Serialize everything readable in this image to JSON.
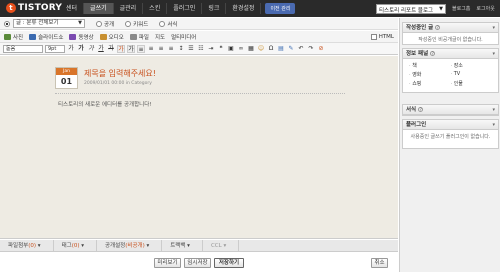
{
  "app": {
    "logo_mark": "t",
    "logo_text": "TISTORY"
  },
  "top_menu": {
    "items": [
      {
        "label": "센터"
      },
      {
        "label": "글쓰기"
      },
      {
        "label": "글관리"
      },
      {
        "label": "스킨"
      },
      {
        "label": "플러그인"
      },
      {
        "label": "링크"
      },
      {
        "label": "환경설정"
      }
    ],
    "preview_button": "이전 관리",
    "blog_select": "티스토리 리포트 블로그",
    "links": [
      "블로그홈",
      "로그아웃"
    ]
  },
  "category_row": {
    "category_label": "글 : 분류 전체보기",
    "options": [
      "공개",
      "키워드",
      "서식"
    ]
  },
  "insert_row": {
    "items": [
      "사진",
      "슬라이드쇼",
      "동영상",
      "오디오",
      "파일",
      "지도",
      "멀티미디어"
    ],
    "html_label": "HTML"
  },
  "format_row": {
    "font_select": "돋움",
    "size_select": "9pt"
  },
  "post": {
    "month": "Jan",
    "day": "01",
    "title": "제목을 입력해주세요!",
    "meta": "2009/01/01 00:00 in Category",
    "body": "티스토리의 새로운 에디터를 공개합니다!"
  },
  "bottom_tabs": [
    {
      "label": "파일첨부",
      "count": "(0)"
    },
    {
      "label": "태그",
      "count": "(0)"
    },
    {
      "label": "공개설정",
      "count": "(비공개)"
    },
    {
      "label": "트랙백"
    },
    {
      "label": "CCL"
    }
  ],
  "actions": {
    "preview": "미리보기",
    "draft": "임시저장",
    "save": "저장하기",
    "cancel": "취소"
  },
  "sidebar": {
    "writing_panel": {
      "title": "작성중인 글",
      "message": "작성중인 비공개글이 없습니다."
    },
    "info_panel": {
      "title": "정보 패널",
      "items": [
        "책",
        "장소",
        "영화",
        "TV",
        "쇼핑",
        "인물"
      ]
    },
    "format_panel": {
      "title": "서식"
    },
    "plugin_panel": {
      "title": "플러그인",
      "message": "사용중인 글쓰기 플러그인이 없습니다."
    }
  },
  "colors": {
    "accent": "#c8501c",
    "topbar": "#2a2a2a",
    "editor_bg": "#eeebe3"
  }
}
